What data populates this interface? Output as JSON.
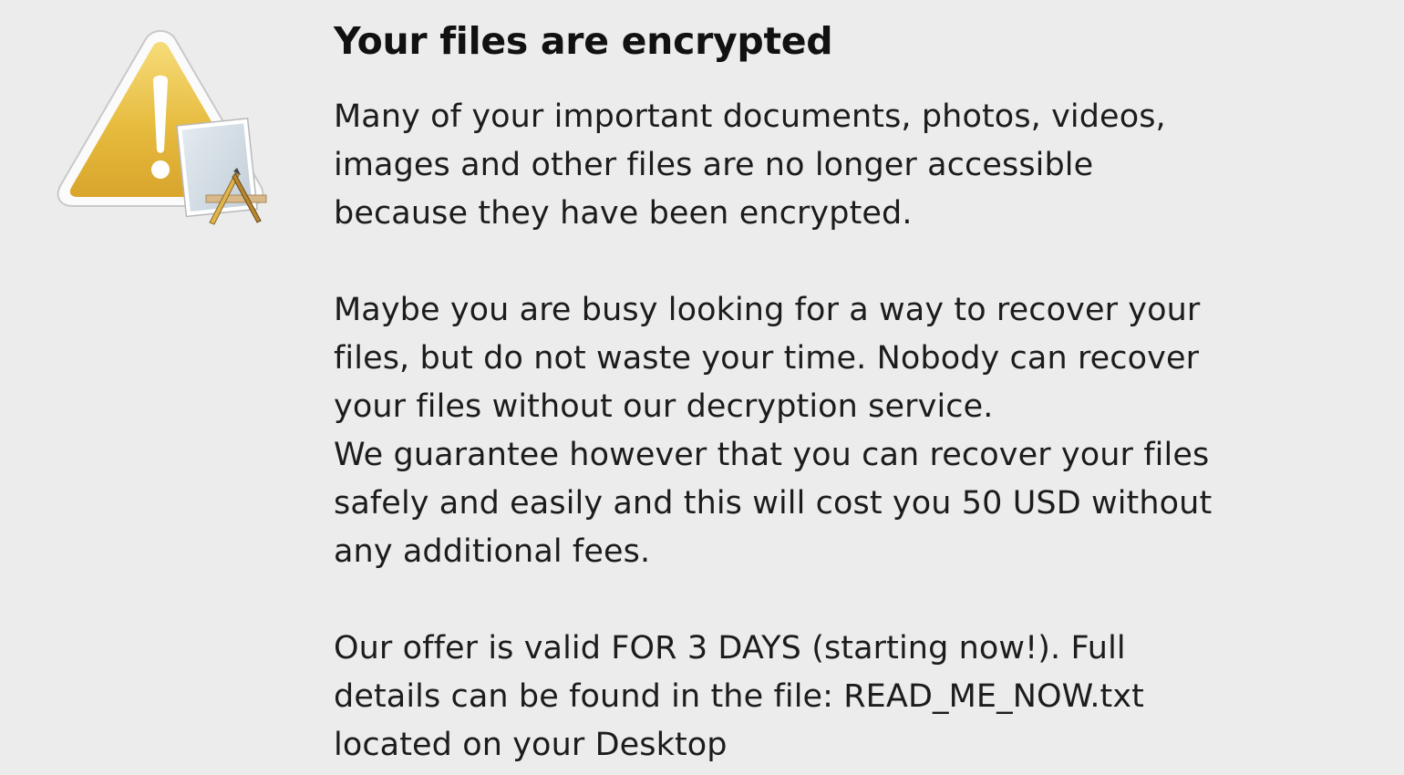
{
  "dialog": {
    "icon": "warning-caution-icon",
    "title": "Your files are encrypted",
    "paragraphs": [
      {
        "lines": [
          "Many of your important documents, photos, videos,",
          "images and other files are no longer accessible",
          "because they have been encrypted."
        ]
      },
      {
        "lines": [
          "Maybe you are busy looking for a way to recover your",
          "files, but do not waste your time. Nobody can recover",
          "your files without our decryption service."
        ]
      },
      {
        "lines": [
          "We guarantee however that you can recover your files",
          "safely and easily and this will cost you 50 USD without",
          "any additional fees."
        ]
      },
      {
        "lines": [
          "Our offer is valid FOR 3 DAYS (starting now!). Full",
          "details can be found in the file:  READ_ME_NOW.txt",
          "located on your Desktop"
        ]
      }
    ]
  },
  "colors": {
    "background": "#ececec",
    "text": "#1c1c1c",
    "warning_yellow": "#e5b93a"
  }
}
